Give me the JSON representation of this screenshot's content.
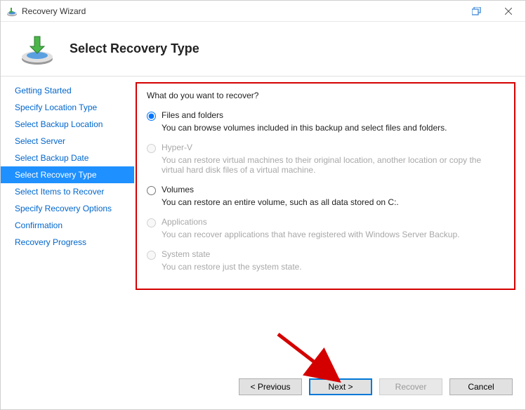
{
  "window": {
    "title": "Recovery Wizard"
  },
  "header": {
    "title": "Select Recovery Type"
  },
  "sidebar": {
    "steps": [
      {
        "label": "Getting Started"
      },
      {
        "label": "Specify Location Type"
      },
      {
        "label": "Select Backup Location"
      },
      {
        "label": "Select Server"
      },
      {
        "label": "Select Backup Date"
      },
      {
        "label": "Select Recovery Type"
      },
      {
        "label": "Select Items to Recover"
      },
      {
        "label": "Specify Recovery Options"
      },
      {
        "label": "Confirmation"
      },
      {
        "label": "Recovery Progress"
      }
    ],
    "active_index": 5
  },
  "main": {
    "prompt": "What do you want to recover?",
    "options": [
      {
        "label": "Files and folders",
        "description": "You can browse volumes included in this backup and select files and folders.",
        "enabled": true,
        "selected": true
      },
      {
        "label": "Hyper-V",
        "description": "You can restore virtual machines to their original location, another location or copy the virtual hard disk files of a virtual machine.",
        "enabled": false,
        "selected": false
      },
      {
        "label": "Volumes",
        "description": "You can restore an entire volume, such as all data stored on C:.",
        "enabled": true,
        "selected": false
      },
      {
        "label": "Applications",
        "description": "You can recover applications that have registered with Windows Server Backup.",
        "enabled": false,
        "selected": false
      },
      {
        "label": "System state",
        "description": "You can restore just the system state.",
        "enabled": false,
        "selected": false
      }
    ]
  },
  "footer": {
    "previous": "< Previous",
    "next": "Next >",
    "recover": "Recover",
    "cancel": "Cancel"
  },
  "colors": {
    "highlight_border": "#d40000",
    "link": "#0066cc",
    "active_bg": "#1e90ff",
    "primary_outline": "#0078d7"
  }
}
